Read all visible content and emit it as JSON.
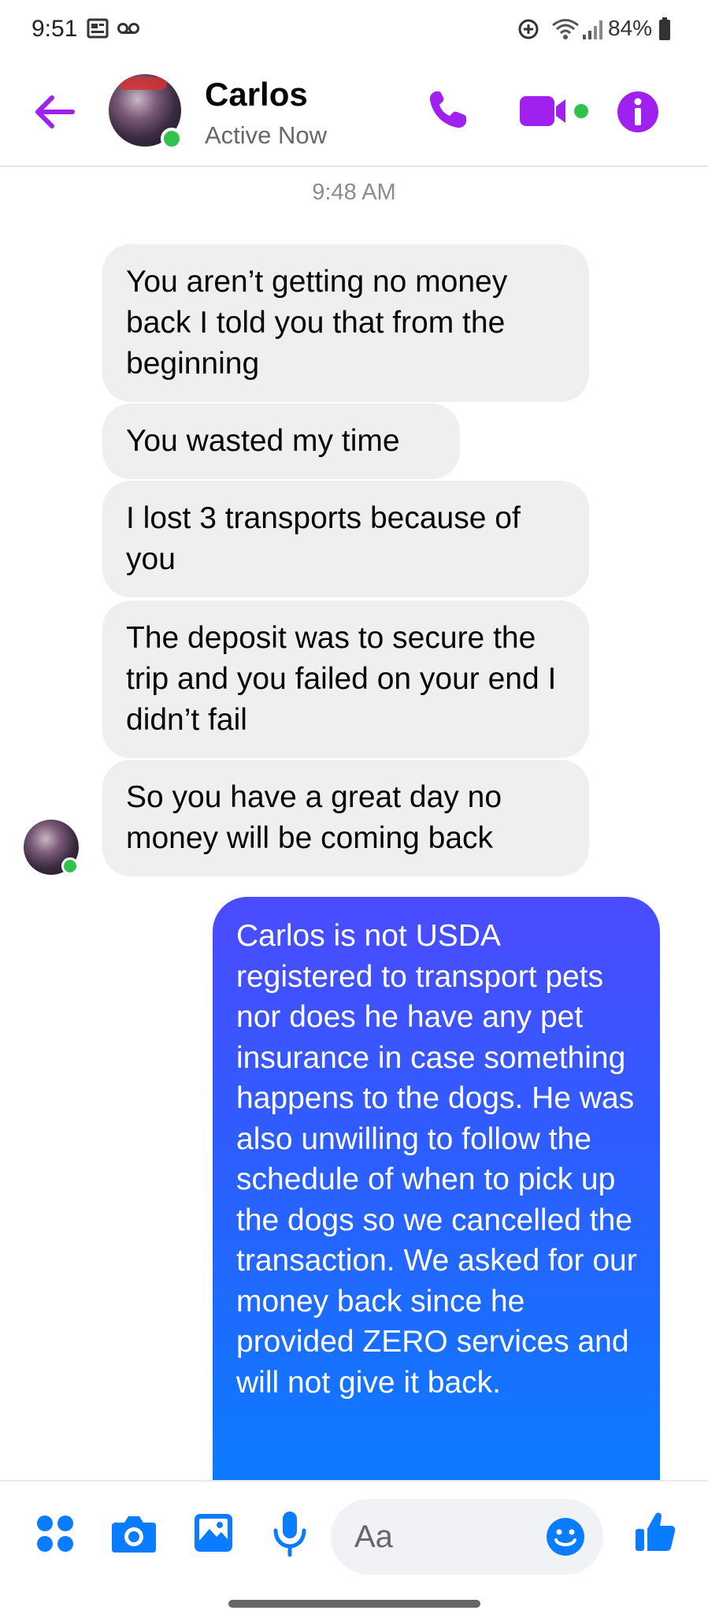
{
  "status_bar": {
    "time": "9:51",
    "battery": "84%"
  },
  "header": {
    "contact_name": "Carlos",
    "contact_status": "Active Now",
    "accent_color": "#a020f0"
  },
  "conversation": {
    "timestamp": "9:48 AM",
    "incoming": [
      "You aren’t getting no money back I told you that from the beginning",
      "You wasted my time",
      "I lost 3 transports because of you",
      "The deposit was to secure the trip and you failed on your end I didn’t fail",
      "So you have a great day no money will be coming back"
    ],
    "outgoing": [
      "Carlos is not USDA registered to transport pets nor does he have any pet insurance in case something happens to the dogs. He was also unwilling to follow the schedule of when to pick up the dogs so we cancelled the transaction. We asked for our money back since he provided ZERO services and will not give it back."
    ]
  },
  "composer": {
    "placeholder": "Aa",
    "icons": [
      "menu-dots-icon",
      "camera-icon",
      "gallery-icon",
      "microphone-icon",
      "emoji-icon",
      "thumbs-up-icon"
    ]
  },
  "colors": {
    "messenger_blue": "#0a7cff",
    "online_green": "#31c24d",
    "incoming_bubble": "#efefef"
  }
}
